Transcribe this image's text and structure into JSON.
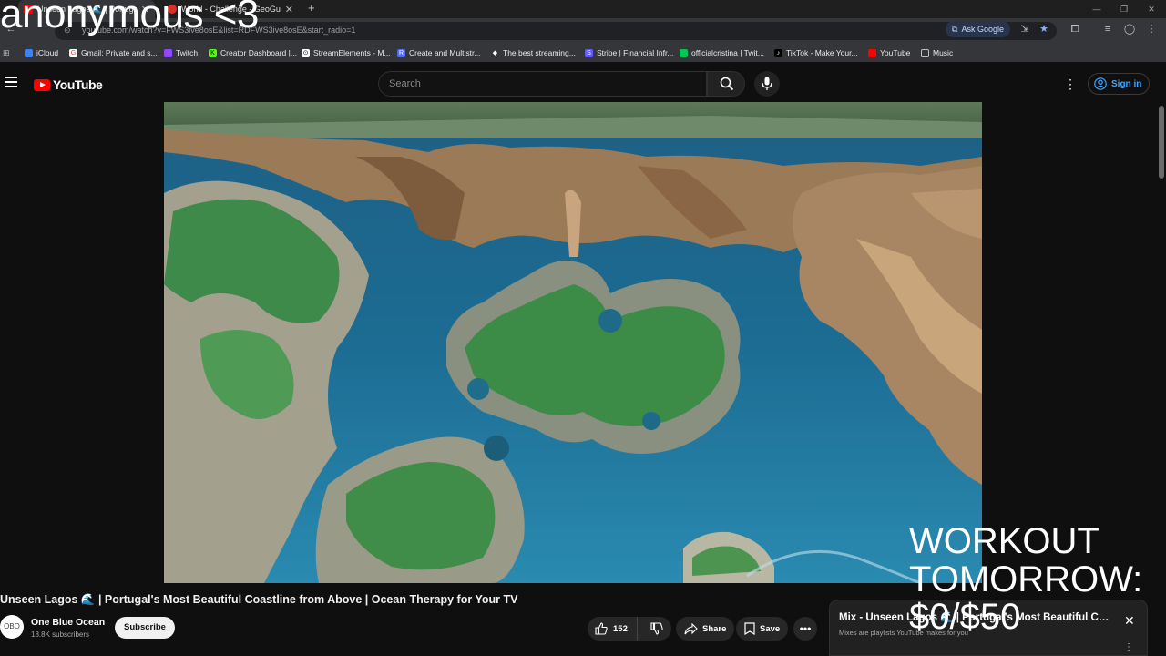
{
  "browser": {
    "tabs": [
      {
        "label": "Unseen Lagos 🌊 | Portugal",
        "active": true,
        "favicon_color": "#ff0000"
      },
      {
        "label": "World - Challenge - GeoGu",
        "active": false,
        "favicon_color": "#d93025"
      }
    ],
    "new_tab": "+",
    "url": "youtube.com/watch?v=FWS3ive8osE&list=RDFWS3ive8osE&start_radio=1",
    "ask_google": "Ask Google",
    "bookmarks": [
      {
        "label": "iCloud",
        "icon_color": "#3b82f6",
        "icon": "cloud"
      },
      {
        "label": "Gmail: Private and s...",
        "icon_color": "#ea4335",
        "icon": "G"
      },
      {
        "label": "Twitch",
        "icon_color": "#9146ff",
        "icon": "twitch"
      },
      {
        "label": "Creator Dashboard |...",
        "icon_color": "#53fc18",
        "icon": "K"
      },
      {
        "label": "StreamElements - M...",
        "icon_color": "#ffffff",
        "icon": "SE"
      },
      {
        "label": "Create and Multistr...",
        "icon_color": "#4f6bed",
        "icon": "R"
      },
      {
        "label": "The best streaming...",
        "icon_color": "#ffffff",
        "icon": "diamond"
      },
      {
        "label": "Stripe | Financial Infr...",
        "icon_color": "#635bff",
        "icon": "S"
      },
      {
        "label": "officialcristina | Twit...",
        "icon_color": "#00c853",
        "icon": "kick"
      },
      {
        "label": "TikTok - Make Your...",
        "icon_color": "#000000",
        "icon": "tiktok"
      },
      {
        "label": "YouTube",
        "icon_color": "#ff0000",
        "icon": "youtube"
      },
      {
        "label": "Music",
        "icon_color": "#bdc1c6",
        "icon": "folder"
      }
    ]
  },
  "yt": {
    "logo_text": "YouTube",
    "search_placeholder": "Search",
    "sign_in": "Sign in"
  },
  "video": {
    "title": "Unseen Lagos 🌊 | Portugal's Most Beautiful Coastline from Above | Ocean Therapy for Your TV",
    "channel": "One Blue Ocean",
    "subscribers": "18.8K subscribers",
    "avatar_text": "OBO",
    "subscribe": "Subscribe",
    "likes": "152",
    "share": "Share",
    "save": "Save"
  },
  "mix": {
    "title": "Mix - Unseen Lagos 🌊 | Portugal's Most Beautiful Coastline",
    "subtitle": "Mixes are playlists YouTube makes for you"
  },
  "overlay": {
    "top_text": "anonymous <3",
    "bottom_line1": "WORKOUT",
    "bottom_line2": "TOMORROW:",
    "bottom_line3": "$0/$50"
  }
}
